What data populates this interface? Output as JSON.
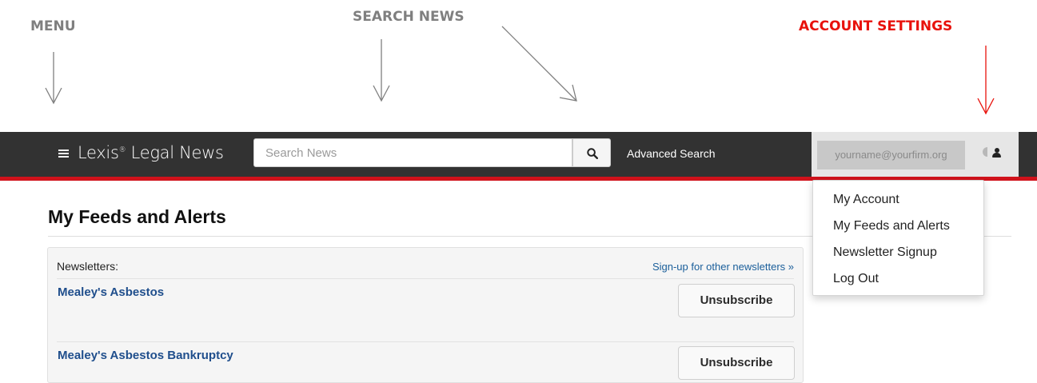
{
  "annotations": {
    "menu": "MENU",
    "search_news": "SEARCH NEWS",
    "account_settings": "ACCOUNT SETTINGS"
  },
  "colors": {
    "navbar_bg": "#323232",
    "accent_red": "#d0121b",
    "annotation_gray": "#7f7f7f",
    "annotation_red": "#e8120c",
    "link_blue": "#1f4e8c"
  },
  "navbar": {
    "menu_icon": "hamburger-icon",
    "brand_name": "Lexis",
    "brand_mark": "®",
    "brand_suffix": " Legal News",
    "search_placeholder": "Search News",
    "search_icon": "search-icon",
    "advanced_search": "Advanced Search",
    "account_email": "yourname@yourfirm.org",
    "user_icon": "user-icon"
  },
  "account_menu": {
    "items": [
      "My Account",
      "My Feeds and Alerts",
      "Newsletter Signup",
      "Log Out"
    ]
  },
  "main": {
    "title": "My Feeds and Alerts",
    "newsletters_label": "Newsletters:",
    "signup_link": "Sign-up for other newsletters »",
    "newsletters": [
      {
        "title": "Mealey's Asbestos",
        "action": "Unsubscribe"
      },
      {
        "title": "Mealey's Asbestos Bankruptcy",
        "action": "Unsubscribe"
      }
    ]
  }
}
